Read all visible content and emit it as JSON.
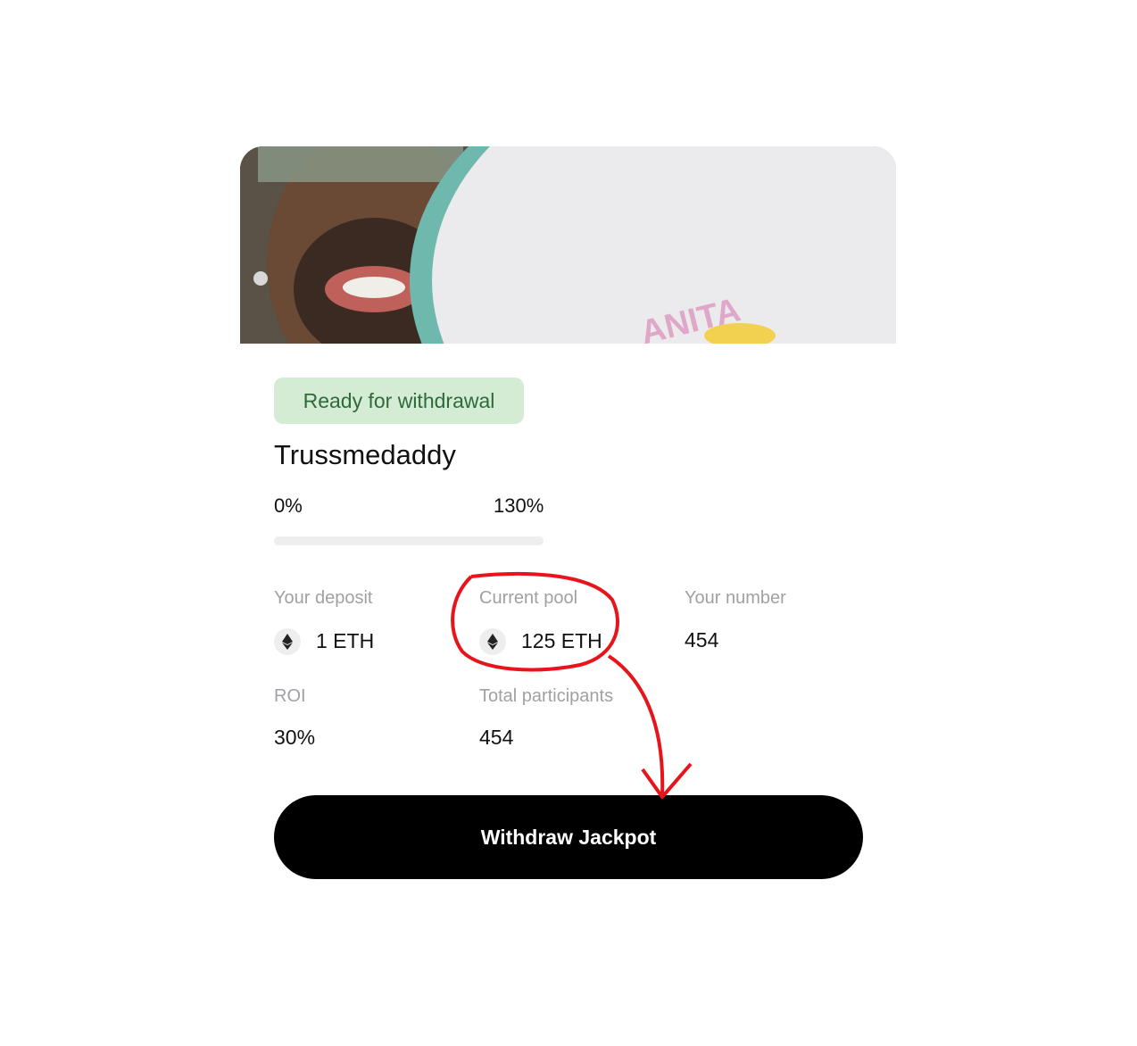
{
  "status_badge": "Ready for withdrawal",
  "title": "Trussmedaddy",
  "progress": {
    "min_label": "0%",
    "max_label": "130%",
    "fill_fraction": 0
  },
  "stats": {
    "deposit_label": "Your deposit",
    "deposit_value": "1 ETH",
    "pool_label": "Current pool",
    "pool_value": "125 ETH",
    "number_label": "Your number",
    "number_value": "454",
    "roi_label": "ROI",
    "roi_value": "30%",
    "participants_label": "Total participants",
    "participants_value": "454"
  },
  "icons": {
    "deposit": "ethereum-icon",
    "pool": "ethereum-icon"
  },
  "button": {
    "label": "Withdraw Jackpot"
  },
  "colors": {
    "badge_bg": "#d4ecd4",
    "badge_text": "#2f6b3a",
    "button_bg": "#000000",
    "annotation": "#e8141c"
  }
}
